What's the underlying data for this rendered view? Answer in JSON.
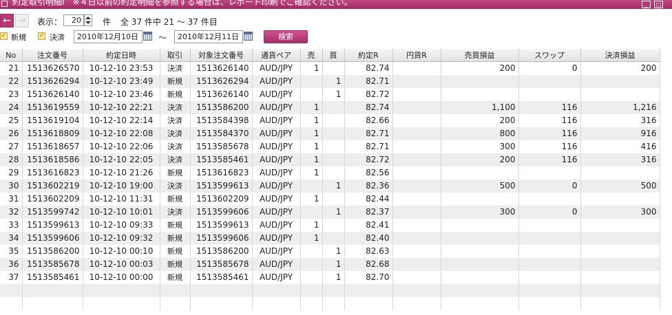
{
  "window": {
    "title": "約定取引明細I　※４日以前の約定明細を参照する場合は、レポート印刷でご確認ください。",
    "min_glyph": "_",
    "close_glyph": "□"
  },
  "toolbar": {
    "back_glyph": "←",
    "forward_glyph": "→",
    "display_label": "表示：",
    "display_count": "20",
    "unit_label": "件",
    "summary": "全 37 件中 21 ～ 37 件目"
  },
  "filter": {
    "check_glyph": "✓",
    "new_label": "新規",
    "settle_label": "決済",
    "date_from": "2010年12月10日",
    "tilde": "～",
    "date_to": "2010年12月11日",
    "search_label": "検索"
  },
  "table": {
    "headers": [
      "No",
      "注文番号",
      "約定日時",
      "取引",
      "対象注文番号",
      "通貨ペア",
      "売",
      "買",
      "約定R",
      "円貨R",
      "売買損益",
      "スワップ",
      "決済損益"
    ],
    "rows": [
      [
        "21",
        "1513626570",
        "10-12-10 23:53",
        "決済",
        "1513626140",
        "AUD/JPY",
        "1",
        "",
        "82.74",
        "",
        "200",
        "0",
        "200"
      ],
      [
        "22",
        "1513626294",
        "10-12-10 23:49",
        "新規",
        "1513626294",
        "AUD/JPY",
        "",
        "1",
        "82.71",
        "",
        "",
        "",
        ""
      ],
      [
        "23",
        "1513626140",
        "10-12-10 23:46",
        "新規",
        "1513626140",
        "AUD/JPY",
        "",
        "1",
        "82.72",
        "",
        "",
        "",
        ""
      ],
      [
        "24",
        "1513619559",
        "10-12-10 22:21",
        "決済",
        "1513586200",
        "AUD/JPY",
        "1",
        "",
        "82.74",
        "",
        "1,100",
        "116",
        "1,216"
      ],
      [
        "25",
        "1513619104",
        "10-12-10 22:14",
        "決済",
        "1513584398",
        "AUD/JPY",
        "1",
        "",
        "82.66",
        "",
        "200",
        "116",
        "316"
      ],
      [
        "26",
        "1513618809",
        "10-12-10 22:08",
        "決済",
        "1513584370",
        "AUD/JPY",
        "1",
        "",
        "82.71",
        "",
        "800",
        "116",
        "916"
      ],
      [
        "27",
        "1513618657",
        "10-12-10 22:06",
        "決済",
        "1513585678",
        "AUD/JPY",
        "1",
        "",
        "82.71",
        "",
        "300",
        "116",
        "416"
      ],
      [
        "28",
        "1513618586",
        "10-12-10 22:05",
        "決済",
        "1513585461",
        "AUD/JPY",
        "1",
        "",
        "82.72",
        "",
        "200",
        "116",
        "316"
      ],
      [
        "29",
        "1513616823",
        "10-12-10 21:26",
        "新規",
        "1513616823",
        "AUD/JPY",
        "1",
        "",
        "82.56",
        "",
        "",
        "",
        ""
      ],
      [
        "30",
        "1513602219",
        "10-12-10 19:00",
        "決済",
        "1513599613",
        "AUD/JPY",
        "",
        "1",
        "82.36",
        "",
        "500",
        "0",
        "500"
      ],
      [
        "31",
        "1513602209",
        "10-12-10 11:31",
        "新規",
        "1513602209",
        "AUD/JPY",
        "1",
        "",
        "82.44",
        "",
        "",
        "",
        ""
      ],
      [
        "32",
        "1513599742",
        "10-12-10 10:01",
        "決済",
        "1513599606",
        "AUD/JPY",
        "",
        "1",
        "82.37",
        "",
        "300",
        "0",
        "300"
      ],
      [
        "33",
        "1513599613",
        "10-12-10 09:33",
        "新規",
        "1513599613",
        "AUD/JPY",
        "1",
        "",
        "82.41",
        "",
        "",
        "",
        ""
      ],
      [
        "34",
        "1513599606",
        "10-12-10 09:32",
        "新規",
        "1513599606",
        "AUD/JPY",
        "1",
        "",
        "82.40",
        "",
        "",
        "",
        ""
      ],
      [
        "35",
        "1513586200",
        "10-12-10 00:10",
        "新規",
        "1513586200",
        "AUD/JPY",
        "",
        "1",
        "82.63",
        "",
        "",
        "",
        ""
      ],
      [
        "36",
        "1513585678",
        "10-12-10 00:03",
        "新規",
        "1513585678",
        "AUD/JPY",
        "",
        "1",
        "82.68",
        "",
        "",
        "",
        ""
      ],
      [
        "37",
        "1513585461",
        "10-12-10 00:00",
        "新規",
        "1513585461",
        "AUD/JPY",
        "",
        "1",
        "82.70",
        "",
        "",
        "",
        ""
      ],
      [
        "",
        "",
        "",
        "",
        "",
        "",
        "",
        "",
        "",
        "",
        "",
        "",
        ""
      ],
      [
        "",
        "",
        "",
        "",
        "",
        "",
        "",
        "",
        "",
        "",
        "",
        "",
        ""
      ]
    ]
  }
}
